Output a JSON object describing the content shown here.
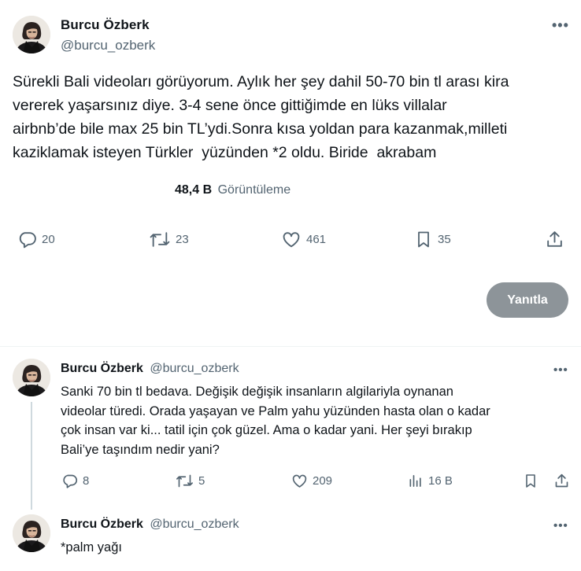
{
  "main_tweet": {
    "author_name": "Burcu Özberk",
    "author_handle": "@burcu_ozberk",
    "text": "Sürekli Bali videoları görüyorum. Aylık her şey dahil 50-70 bin tl arası kira\nvererek yaşarsınız diye. 3-4 sene önce gittiğimde en lüks villalar\nairbnb’de bile max 25 bin TL’ydi.Sonra kısa yoldan para kazanmak,milleti\nkaziklamak isteyen Türkler  yüzünden *2 oldu. Biride  akrabam",
    "views_count": "48,4 B",
    "views_label": "Görüntüleme",
    "replies": "20",
    "reposts": "23",
    "likes": "461",
    "bookmarks": "35",
    "reply_button_label": "Yanıtla"
  },
  "replies": [
    {
      "author_name": "Burcu Özberk",
      "author_handle": "@burcu_ozberk",
      "text": "Sanki 70 bin tl bedava. Değişik değişik insanların algilariyla oynanan\nvideolar türedi. Orada yaşayan ve Palm yahu yüzünden hasta olan o kadar\nçok insan var ki... tatil için çok güzel. Ama o kadar yani. Her şeyi bırakıp\nBali’ye taşındım nedir yani?",
      "replies": "8",
      "reposts": "5",
      "likes": "209",
      "views": "16 B"
    },
    {
      "author_name": "Burcu Özberk",
      "author_handle": "@burcu_ozberk",
      "text": "*palm yağı"
    }
  ],
  "icons": {
    "more": "more-horizontal-icon",
    "reply": "reply-bubble-icon",
    "repost": "repost-icon",
    "like": "heart-icon",
    "bookmark": "bookmark-icon",
    "share": "share-icon",
    "views": "analytics-icon"
  },
  "colors": {
    "text_primary": "#0f1419",
    "text_secondary": "#536471",
    "reply_button_disabled": "#8d9499",
    "divider": "#eff3f4"
  }
}
